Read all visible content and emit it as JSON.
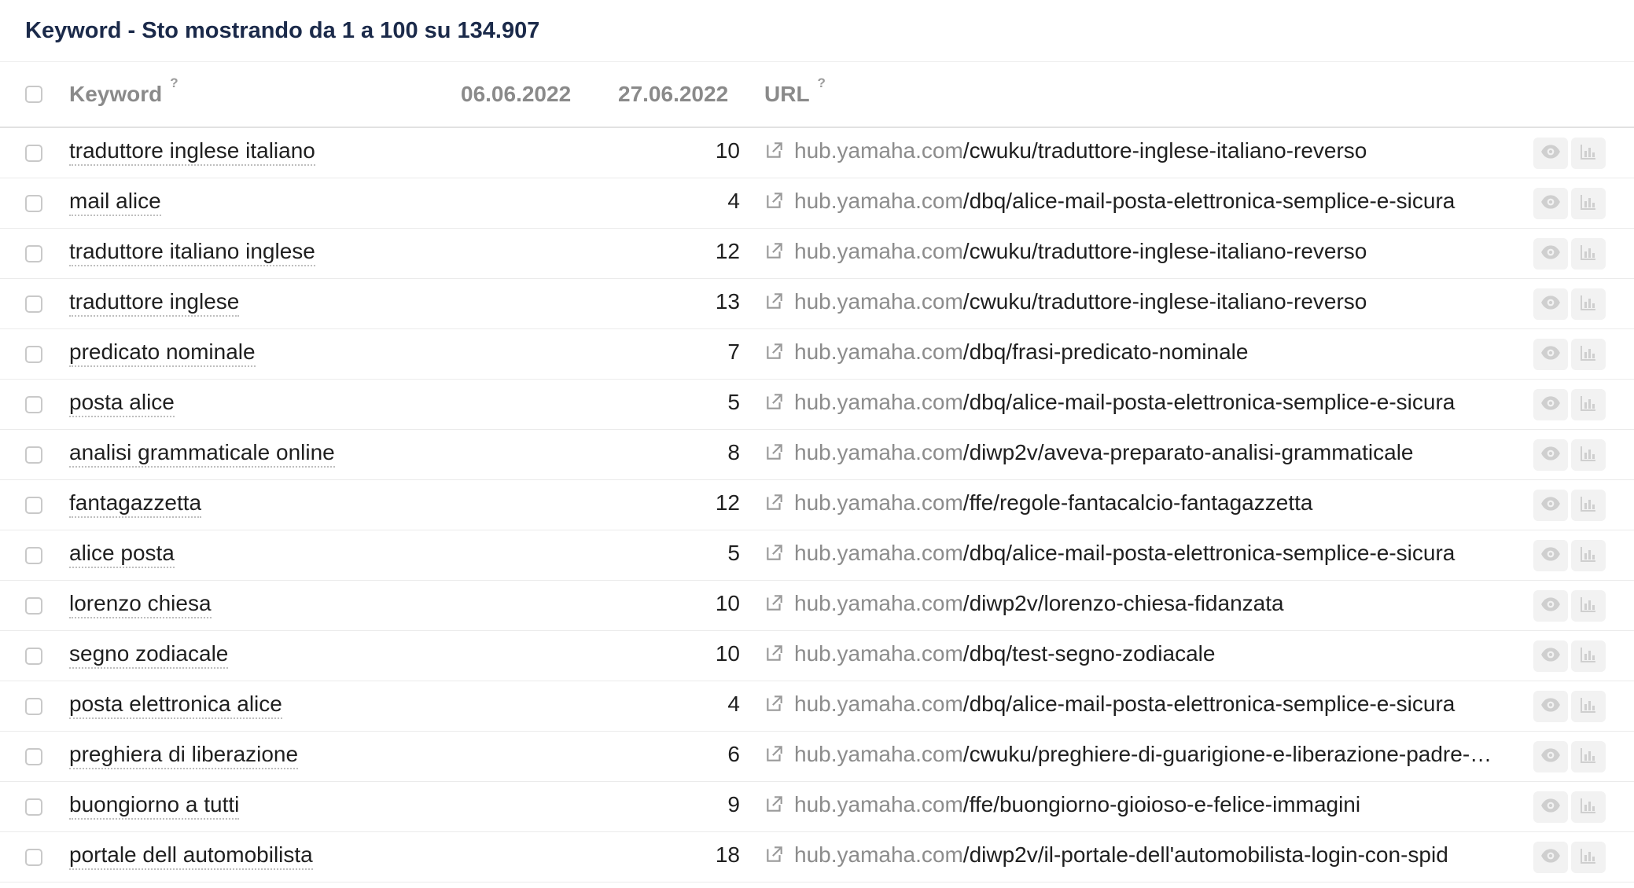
{
  "panel": {
    "title": "Keyword - Sto mostrando da 1 a 100 su 134.907"
  },
  "columns": {
    "keyword": "Keyword",
    "keyword_help": "?",
    "date1": "06.06.2022",
    "date2": "27.06.2022",
    "url": "URL",
    "url_help": "?"
  },
  "rows": [
    {
      "keyword": "traduttore inglese italiano",
      "position": "10",
      "domain": "hub.yamaha.com",
      "path": "/cwuku/traduttore-inglese-italiano-reverso"
    },
    {
      "keyword": "mail alice",
      "position": "4",
      "domain": "hub.yamaha.com",
      "path": "/dbq/alice-mail-posta-elettronica-semplice-e-sicura"
    },
    {
      "keyword": "traduttore italiano inglese",
      "position": "12",
      "domain": "hub.yamaha.com",
      "path": "/cwuku/traduttore-inglese-italiano-reverso"
    },
    {
      "keyword": "traduttore inglese",
      "position": "13",
      "domain": "hub.yamaha.com",
      "path": "/cwuku/traduttore-inglese-italiano-reverso"
    },
    {
      "keyword": "predicato nominale",
      "position": "7",
      "domain": "hub.yamaha.com",
      "path": "/dbq/frasi-predicato-nominale"
    },
    {
      "keyword": "posta alice",
      "position": "5",
      "domain": "hub.yamaha.com",
      "path": "/dbq/alice-mail-posta-elettronica-semplice-e-sicura"
    },
    {
      "keyword": "analisi grammaticale online",
      "position": "8",
      "domain": "hub.yamaha.com",
      "path": "/diwp2v/aveva-preparato-analisi-grammaticale"
    },
    {
      "keyword": "fantagazzetta",
      "position": "12",
      "domain": "hub.yamaha.com",
      "path": "/ffe/regole-fantacalcio-fantagazzetta"
    },
    {
      "keyword": "alice posta",
      "position": "5",
      "domain": "hub.yamaha.com",
      "path": "/dbq/alice-mail-posta-elettronica-semplice-e-sicura"
    },
    {
      "keyword": "lorenzo chiesa",
      "position": "10",
      "domain": "hub.yamaha.com",
      "path": "/diwp2v/lorenzo-chiesa-fidanzata"
    },
    {
      "keyword": "segno zodiacale",
      "position": "10",
      "domain": "hub.yamaha.com",
      "path": "/dbq/test-segno-zodiacale"
    },
    {
      "keyword": "posta elettronica alice",
      "position": "4",
      "domain": "hub.yamaha.com",
      "path": "/dbq/alice-mail-posta-elettronica-semplice-e-sicura"
    },
    {
      "keyword": "preghiera di liberazione",
      "position": "6",
      "domain": "hub.yamaha.com",
      "path": "/cwuku/preghiere-di-guarigione-e-liberazione-padre-a..."
    },
    {
      "keyword": "buongiorno a tutti",
      "position": "9",
      "domain": "hub.yamaha.com",
      "path": "/ffe/buongiorno-gioioso-e-felice-immagini"
    },
    {
      "keyword": "portale dell automobilista",
      "position": "18",
      "domain": "hub.yamaha.com",
      "path": "/diwp2v/il-portale-dell'automobilista-login-con-spid"
    }
  ],
  "icons": {
    "external": "external-link-icon",
    "view": "eye-icon",
    "chart": "bar-chart-icon"
  },
  "colors": {
    "title": "#1b2a4a",
    "header_text": "#8a8a8a",
    "domain": "#8c8c8c",
    "action_bg": "#f2f2f2",
    "icon": "#cfcfcf"
  }
}
